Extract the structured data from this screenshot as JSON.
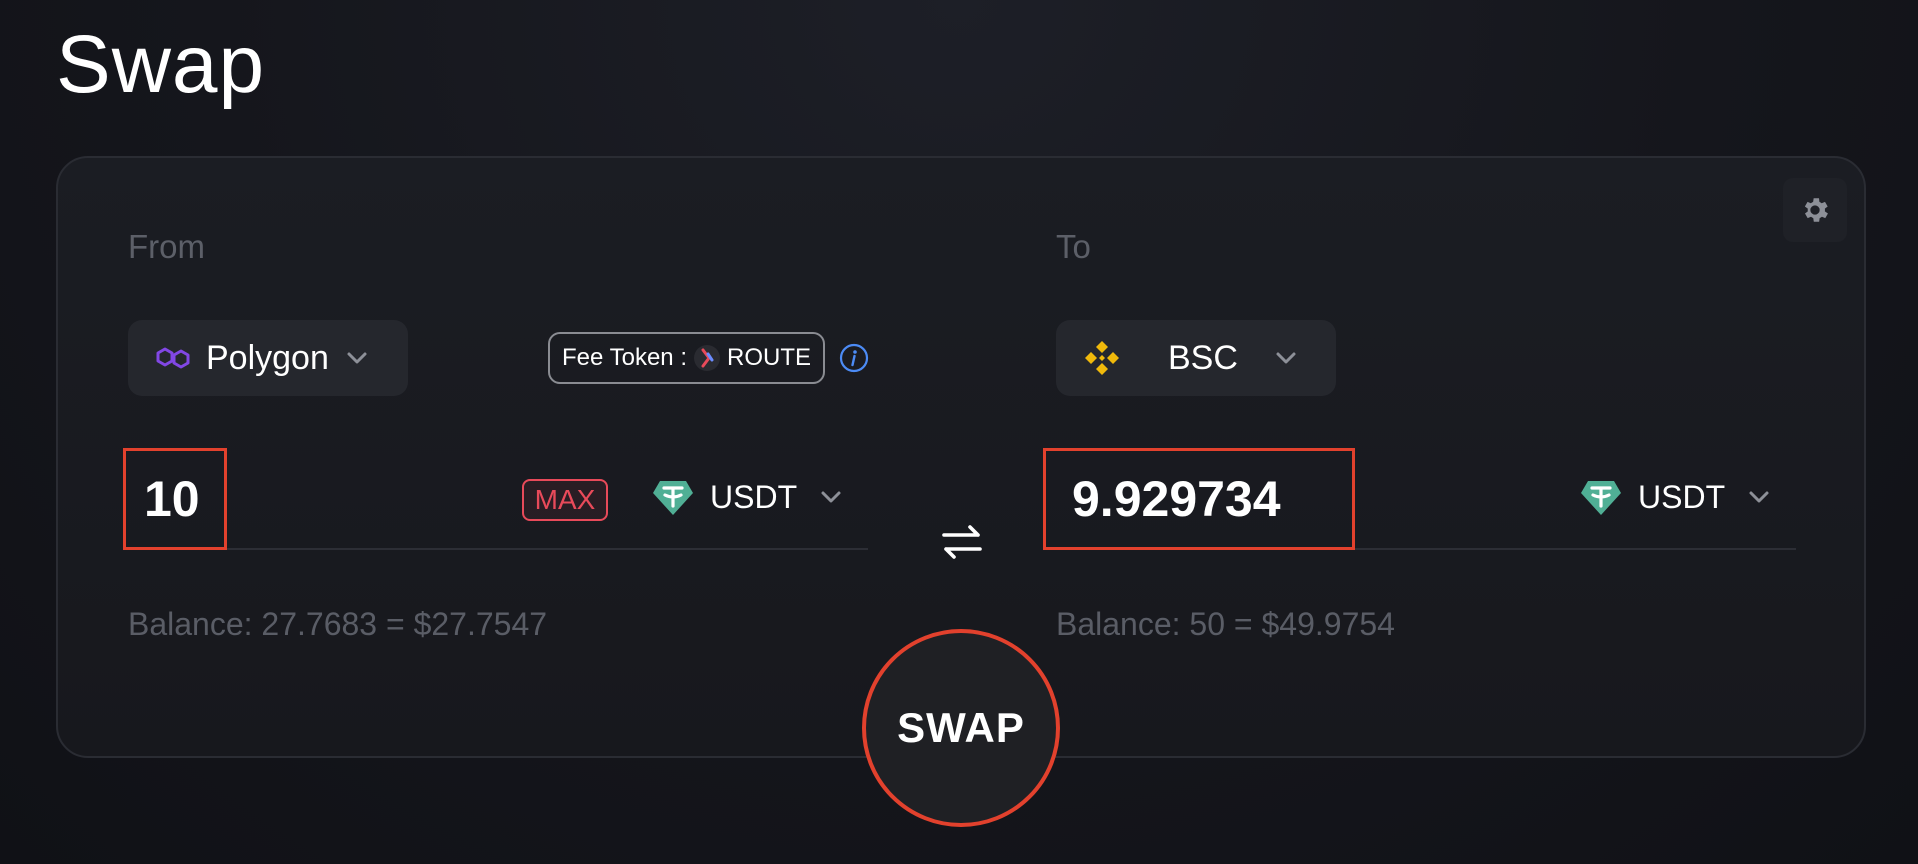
{
  "page": {
    "title": "Swap"
  },
  "from": {
    "label": "From",
    "chain": "Polygon",
    "amount": "10",
    "max_label": "MAX",
    "token": "USDT",
    "balance": "Balance: 27.7683 = $27.7547"
  },
  "fee": {
    "prefix": "Fee Token :",
    "token": "ROUTE"
  },
  "to": {
    "label": "To",
    "chain": "BSC",
    "amount": "9.929734",
    "token": "USDT",
    "balance": "Balance: 50 = $49.9754"
  },
  "actions": {
    "swap_label": "SWAP"
  },
  "colors": {
    "highlight": "#e2412d",
    "max": "#e84a5a",
    "polygon": "#8247e5",
    "bsc": "#f0b90b",
    "usdt": "#50af95",
    "info": "#4c8bf5"
  }
}
